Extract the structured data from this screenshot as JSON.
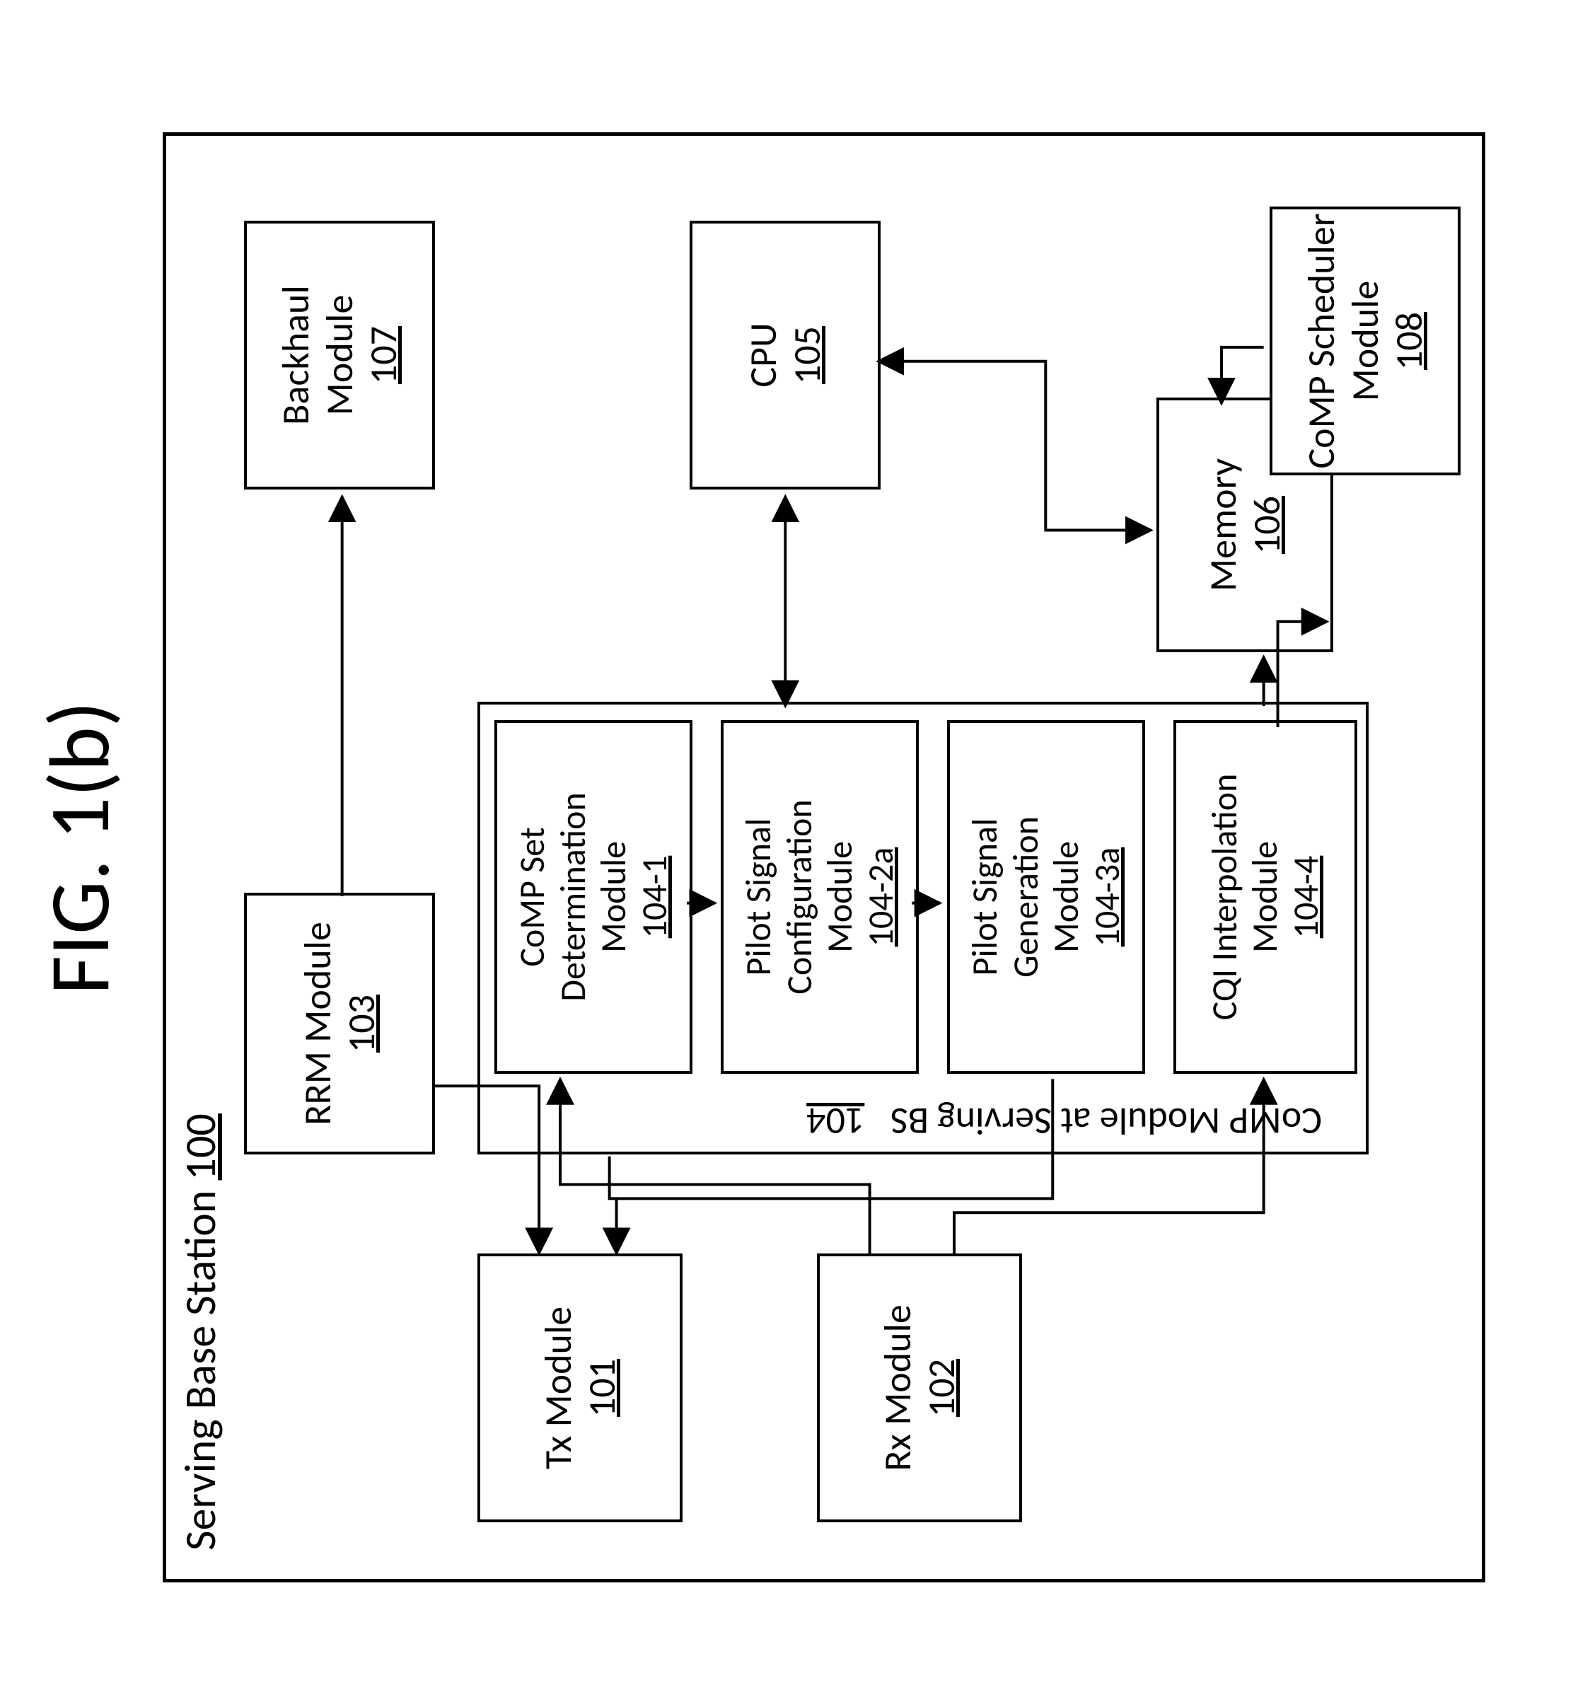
{
  "figure_label": "FIG. 1(b)",
  "container": {
    "title": "Serving Base Station",
    "ref": "100"
  },
  "blocks": {
    "tx": {
      "title": "Tx Module",
      "ref": "101"
    },
    "rx": {
      "title": "Rx Module",
      "ref": "102"
    },
    "rrm": {
      "title": "RRM Module",
      "ref": "103"
    },
    "backhaul": {
      "title": "Backhaul Module",
      "ref": "107"
    },
    "cpu": {
      "title": "CPU",
      "ref": "105"
    },
    "memory": {
      "title": "Memory",
      "ref": "106"
    },
    "scheduler": {
      "title": "CoMP Scheduler Module",
      "ref": "108"
    },
    "comp_container": {
      "title": "CoMP Module at Serving BS",
      "ref": "104"
    },
    "comp_set": {
      "title": "CoMP Set Determination Module",
      "ref": "104-1"
    },
    "pilot_cfg": {
      "title": "Pilot Signal Configuration Module",
      "ref": "104-2a"
    },
    "pilot_gen": {
      "title": "Pilot Signal Generation Module",
      "ref": "104-3a"
    },
    "cqi": {
      "title": "CQI Interpolation Module",
      "ref": "104-4"
    }
  }
}
